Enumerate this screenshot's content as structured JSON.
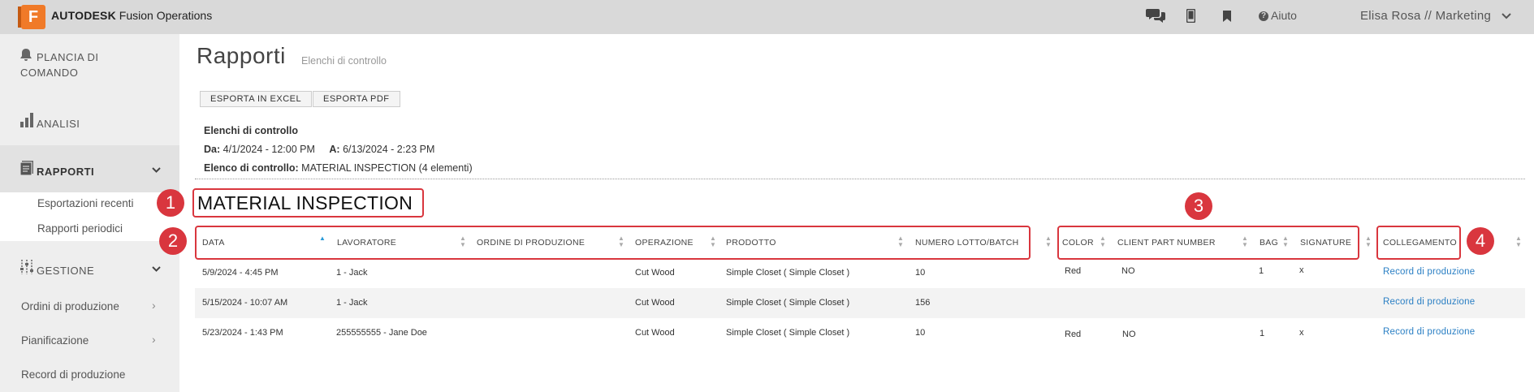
{
  "topbar": {
    "logo_letter": "F",
    "brand_bold": "AUTODESK",
    "brand_rest": " Fusion Operations",
    "chat_icon": "chat-icon",
    "mobile_icon": "mobile-icon",
    "bookmark_icon": "bookmark-icon",
    "help_label": "Aiuto",
    "user_label": "Elisa Rosa // Marketing"
  },
  "sidebar": {
    "dashboard_line1": "PLANCIA DI",
    "dashboard_line2": "COMANDO",
    "analytics": "ANALISI",
    "reports": "RAPPORTI",
    "reports_sub": [
      "Esportazioni recenti",
      "Rapporti periodici"
    ],
    "management": "GESTIONE",
    "links": [
      "Ordini di produzione",
      "Pianificazione",
      "Record di produzione"
    ]
  },
  "page": {
    "title": "Rapporti",
    "subtitle": "Elenchi di controllo",
    "export_excel": "ESPORTA IN EXCEL",
    "export_pdf": "ESPORTA PDF",
    "info_heading": "Elenchi di controllo",
    "from_label": "Da:",
    "from_value": "4/1/2024 - 12:00 PM",
    "to_label": "A:",
    "to_value": "6/13/2024 - 2:23 PM",
    "list_label": "Elenco di controllo:",
    "list_value": "MATERIAL INSPECTION (4 elementi)"
  },
  "section": {
    "title": "MATERIAL INSPECTION"
  },
  "table": {
    "headers": [
      "DATA",
      "LAVORATORE",
      "ORDINE DI PRODUZIONE",
      "OPERAZIONE",
      "PRODOTTO",
      "NUMERO LOTTO/BATCH",
      "COLOR",
      "CLIENT PART NUMBER",
      "BAG",
      "SIGNATURE",
      "COLLEGAMENTO"
    ],
    "rows": [
      {
        "data": "5/9/2024 - 4:45 PM",
        "worker": "1 - Jack",
        "order": "",
        "operation": "Cut Wood",
        "product": "Simple Closet ( Simple Closet )",
        "lot": "10",
        "color": "Red",
        "client_part": "NO",
        "bag": "1",
        "signature": "x",
        "link": "Record di produzione"
      },
      {
        "data": "5/15/2024 - 10:07 AM",
        "worker": "1 - Jack",
        "order": "",
        "operation": "Cut Wood",
        "product": "Simple Closet ( Simple Closet )",
        "lot": "156",
        "color": "",
        "client_part": "",
        "bag": "",
        "signature": "",
        "link": "Record di produzione"
      },
      {
        "data": "5/23/2024 - 1:43 PM",
        "worker": "255555555 - Jane Doe",
        "order": "",
        "operation": "Cut Wood",
        "product": "Simple Closet ( Simple Closet )",
        "lot": "10",
        "color": "Red",
        "client_part": "NO",
        "bag": "1",
        "signature": "x",
        "link": "Record di produzione"
      }
    ]
  },
  "annotations": [
    "1",
    "2",
    "3",
    "4"
  ],
  "colors": {
    "accent": "#d9363e",
    "link": "#2a7fc4",
    "brand_orange": "#f07a28",
    "sort_active": "#2a9bd8"
  }
}
